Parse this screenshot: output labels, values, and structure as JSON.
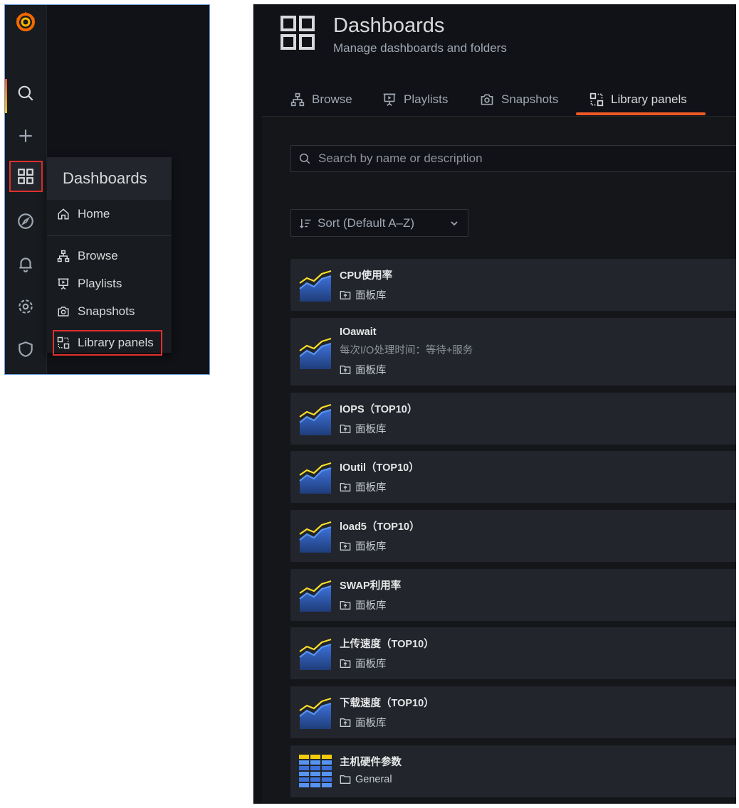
{
  "nav_menu": {
    "header": "Dashboards",
    "items": [
      {
        "label": "Home",
        "icon": "home-icon"
      },
      {
        "label": "Browse",
        "icon": "sitemap-icon"
      },
      {
        "label": "Playlists",
        "icon": "presentation-play-icon"
      },
      {
        "label": "Snapshots",
        "icon": "camera-icon"
      },
      {
        "label": "Library panels",
        "icon": "library-panel-icon"
      }
    ]
  },
  "sidebar_icons": [
    "grafana-logo",
    "search-icon",
    "plus-icon",
    "apps-icon",
    "compass-icon",
    "bell-icon",
    "cog-icon",
    "shield-icon"
  ],
  "page": {
    "title": "Dashboards",
    "subtitle": "Manage dashboards and folders"
  },
  "tabs": [
    {
      "label": "Browse",
      "icon": "sitemap-icon",
      "active": false
    },
    {
      "label": "Playlists",
      "icon": "presentation-play-icon",
      "active": false
    },
    {
      "label": "Snapshots",
      "icon": "camera-icon",
      "active": false
    },
    {
      "label": "Library panels",
      "icon": "library-panel-icon",
      "active": true
    }
  ],
  "search": {
    "placeholder": "Search by name or description"
  },
  "sort": {
    "label": "Sort (Default A–Z)"
  },
  "panels": [
    {
      "title": "CPU使用率",
      "description": "",
      "folder": "面板库",
      "type": "graph"
    },
    {
      "title": "IOawait",
      "description": "每次I/O处理时间：等待+服务",
      "folder": "面板库",
      "type": "graph"
    },
    {
      "title": "IOPS（TOP10）",
      "description": "",
      "folder": "面板库",
      "type": "graph"
    },
    {
      "title": "IOutil（TOP10）",
      "description": "",
      "folder": "面板库",
      "type": "graph"
    },
    {
      "title": "load5（TOP10）",
      "description": "",
      "folder": "面板库",
      "type": "graph"
    },
    {
      "title": "SWAP利用率",
      "description": "",
      "folder": "面板库",
      "type": "graph"
    },
    {
      "title": "上传速度（TOP10）",
      "description": "",
      "folder": "面板库",
      "type": "graph"
    },
    {
      "title": "下载速度（TOP10）",
      "description": "",
      "folder": "面板库",
      "type": "graph"
    },
    {
      "title": "主机硬件参数",
      "description": "",
      "folder": "General",
      "type": "table"
    }
  ],
  "colors": {
    "accent": "#f05a28",
    "highlight_box": "#e02f2f",
    "card_bg": "#22252b",
    "page_bg": "#111217"
  }
}
